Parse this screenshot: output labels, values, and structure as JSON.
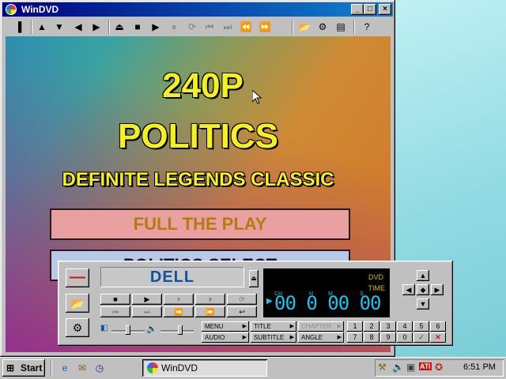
{
  "window": {
    "title": "WinDVD",
    "minimize": "_",
    "maximize": "□",
    "close": "×"
  },
  "toolbar": {
    "icons": [
      "▐",
      "▲",
      "▼",
      "◀",
      "▶",
      "⏏",
      "■",
      "▶",
      "⏸",
      "⟳",
      "⏮",
      "⏭",
      "⏪",
      "⏩",
      "📂",
      "⚙",
      "▤",
      "?"
    ]
  },
  "video": {
    "line1": "240P",
    "line2": "POLITICS",
    "line3": "DEFINITE LEGENDS CLASSIC",
    "menu1": "FULL THE PLAY",
    "menu2": "POLITICS SELECT"
  },
  "panel": {
    "brand": "DELL",
    "lcd": {
      "dvd": "DVD",
      "time": "TIME",
      "ch": "CH",
      "h": "H",
      "m": "M",
      "s": "S",
      "digits": "00 0 00 00"
    },
    "menu_buttons": [
      {
        "label": "MENU"
      },
      {
        "label": "TITLE"
      },
      {
        "label": "CHAPTER"
      },
      {
        "label": "AUDIO"
      },
      {
        "label": "SUBTITLE"
      },
      {
        "label": "ANGLE"
      }
    ],
    "keypad_row1": [
      "1",
      "2",
      "3",
      "4",
      "5",
      "6"
    ],
    "keypad_row2": [
      "7",
      "8",
      "9",
      "0",
      "✓",
      "✕"
    ],
    "volume_level": 0.6
  },
  "taskbar": {
    "start": "Start",
    "task": "WinDVD",
    "clock": "6:51 PM"
  },
  "colors": {
    "accent": "#000080",
    "lcd_digits": "#19c6f0",
    "lcd_labels": "#d8c000",
    "brand": "#1450a0"
  }
}
